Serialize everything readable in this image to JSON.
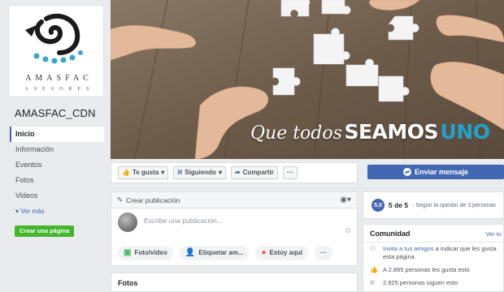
{
  "page": {
    "name": "AMASFAC_CDN",
    "logo": {
      "main": "AMASFAC",
      "sub": "ASESORES"
    }
  },
  "nav": {
    "items": [
      {
        "label": "Inicio",
        "active": true
      },
      {
        "label": "Información"
      },
      {
        "label": "Eventos"
      },
      {
        "label": "Fotos"
      },
      {
        "label": "Videos"
      }
    ],
    "more": "Ver más",
    "create_page": "Crear una página"
  },
  "cover": {
    "slogan_script": "Que todos",
    "slogan_bold": "SEAMOS",
    "slogan_accent": "UNO"
  },
  "actions": {
    "like": "Te gusta",
    "following": "Siguiendo",
    "share": "Compartir",
    "more": "···",
    "send_message": "Enviar mensaje"
  },
  "composer": {
    "title": "Crear publicación",
    "placeholder": "Escribe una publicación...",
    "buttons": {
      "photo": "Foto/video",
      "tag": "Etiquetar am...",
      "location": "Estoy aquí",
      "more": "···"
    }
  },
  "photos": {
    "title": "Fotos"
  },
  "rating": {
    "score": "5,0",
    "main": "5 de 5",
    "sub": "· Según la opinión de 3 personas"
  },
  "community": {
    "title": "Comunidad",
    "see_all": "Ver to",
    "invite_link": "Invita a tus amigos",
    "invite_rest": " a indicar que les gusta esta página",
    "likes": "A 2.865 personas les gusta esto",
    "followers": "2.925 personas siguen esto"
  },
  "colors": {
    "brand_blue": "#4267b2",
    "create_green": "#42b72a",
    "slogan_accent": "#1fa3c9"
  }
}
